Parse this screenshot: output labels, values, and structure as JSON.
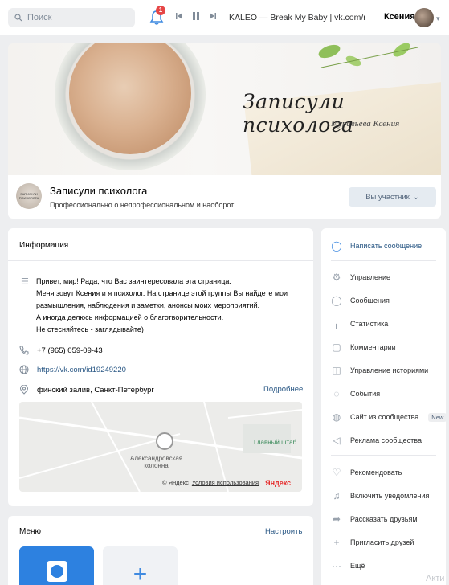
{
  "topbar": {
    "search_placeholder": "Поиск",
    "notification_count": "1",
    "track": "KALEO — Break My Baby | vk.com/re...",
    "username": "Ксения"
  },
  "cover": {
    "title": "Записули психолога",
    "subtitle": "Муравьева Ксения",
    "avatar_text": "ЗАПИСУЛИ ПСИХОЛОГА"
  },
  "group": {
    "name": "Записули психолога",
    "status": "Профессионально о непрофессиональном и наоборот",
    "member_button": "Вы участник"
  },
  "info": {
    "title": "Информация",
    "about_lines": [
      "Привет, мир! Рада, что Вас заинтересовала эта страница.",
      "Меня зовут Ксения и я психолог. На странице этой группы Вы найдете мои",
      "размышления, наблюдения и заметки, анонсы моих мероприятий.",
      "А иногда делюсь информацией о благотворительности.",
      "Не стесняйтесь - заглядывайте)"
    ],
    "phone": "+7 (965) 059-09-43",
    "website": "https://vk.com/id19249220",
    "address": "финский залив, Санкт-Петербург",
    "more": "Подробнее",
    "map_label_1": "Александровская",
    "map_label_2": "колонна",
    "map_green": "Главный штаб",
    "map_copyright": "© Яндекс",
    "map_terms": "Условия использования",
    "map_brand": "Яндекс"
  },
  "menu": {
    "title": "Меню",
    "setup": "Настроить",
    "add_symbol": "+"
  },
  "sidebar": {
    "items": [
      {
        "label": "Написать сообщение",
        "icon": "message-icon"
      },
      {
        "label": "Управление",
        "icon": "gear-icon"
      },
      {
        "label": "Сообщения",
        "icon": "chat-icon"
      },
      {
        "label": "Статистика",
        "icon": "stats-icon"
      },
      {
        "label": "Комментарии",
        "icon": "comment-icon"
      },
      {
        "label": "Управление историями",
        "icon": "stories-icon"
      },
      {
        "label": "События",
        "icon": "events-icon"
      },
      {
        "label": "Сайт из сообщества",
        "icon": "globe-icon",
        "badge": "New"
      },
      {
        "label": "Реклама сообщества",
        "icon": "megaphone-icon"
      },
      {
        "label": "Рекомендовать",
        "icon": "like-icon"
      },
      {
        "label": "Включить уведомления",
        "icon": "bell-icon"
      },
      {
        "label": "Рассказать друзьям",
        "icon": "share-icon"
      },
      {
        "label": "Пригласить друзей",
        "icon": "add-user-icon"
      },
      {
        "label": "Ещё",
        "icon": "more-icon"
      }
    ]
  },
  "corner": "Акти",
  "colors": {
    "accent": "#2a5885",
    "blue_icon": "#3f8ae0",
    "badge_red": "#e64646",
    "page_bg": "#edeef0"
  }
}
